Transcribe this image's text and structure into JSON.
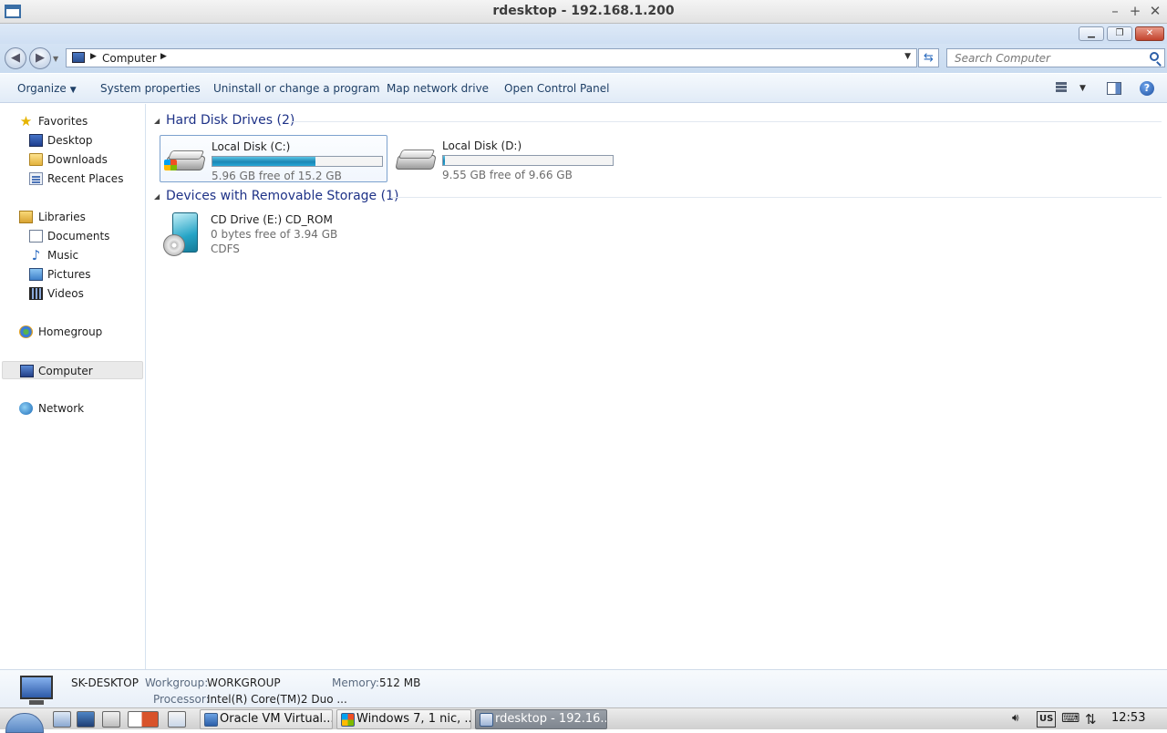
{
  "host_window": {
    "title": "rdesktop - 192.168.1.200",
    "controls": {
      "minimize": "–",
      "maximize": "+",
      "close": "✕"
    }
  },
  "explorer": {
    "address": {
      "crumb": "Computer"
    },
    "search": {
      "placeholder": "Search Computer"
    },
    "commands": {
      "organize": "Organize",
      "system_properties": "System properties",
      "uninstall": "Uninstall or change a program",
      "map_drive": "Map network drive",
      "control_panel": "Open Control Panel"
    },
    "nav_pane": {
      "favorites": "Favorites",
      "desktop": "Desktop",
      "downloads": "Downloads",
      "recent_places": "Recent Places",
      "libraries": "Libraries",
      "documents": "Documents",
      "music": "Music",
      "pictures": "Pictures",
      "videos": "Videos",
      "homegroup": "Homegroup",
      "computer": "Computer",
      "network": "Network"
    },
    "groups": {
      "hard_disks": {
        "title": "Hard Disk Drives (2)",
        "drives": [
          {
            "name": "Local Disk (C:)",
            "free_text": "5.96 GB free of 15.2 GB",
            "used_fraction": 0.61,
            "bar_color": "#1a86b5"
          },
          {
            "name": "Local Disk (D:)",
            "free_text": "9.55 GB free of 9.66 GB",
            "used_fraction": 0.01,
            "bar_color": "#1a86b5"
          }
        ]
      },
      "removable": {
        "title": "Devices with Removable Storage (1)",
        "devices": [
          {
            "name": "CD Drive (E:) CD_ROM",
            "free_text": "0 bytes free of 3.94 GB",
            "filesystem": "CDFS"
          }
        ]
      }
    },
    "details": {
      "computer_name": "SK-DESKTOP",
      "workgroup_label": "Workgroup:",
      "workgroup_value": "WORKGROUP",
      "memory_label": "Memory:",
      "memory_value": "512 MB",
      "processor_label": "Processor:",
      "processor_value": "Intel(R) Core(TM)2 Duo ..."
    }
  },
  "taskbar": {
    "tasks": [
      {
        "label": "Oracle VM Virtual...",
        "active": false
      },
      {
        "label": "Windows 7, 1 nic, ...",
        "active": false
      },
      {
        "label": "rdesktop - 192.16...",
        "active": true
      }
    ],
    "tray": {
      "keyboard_layout": "US",
      "clock": "12:53"
    }
  }
}
